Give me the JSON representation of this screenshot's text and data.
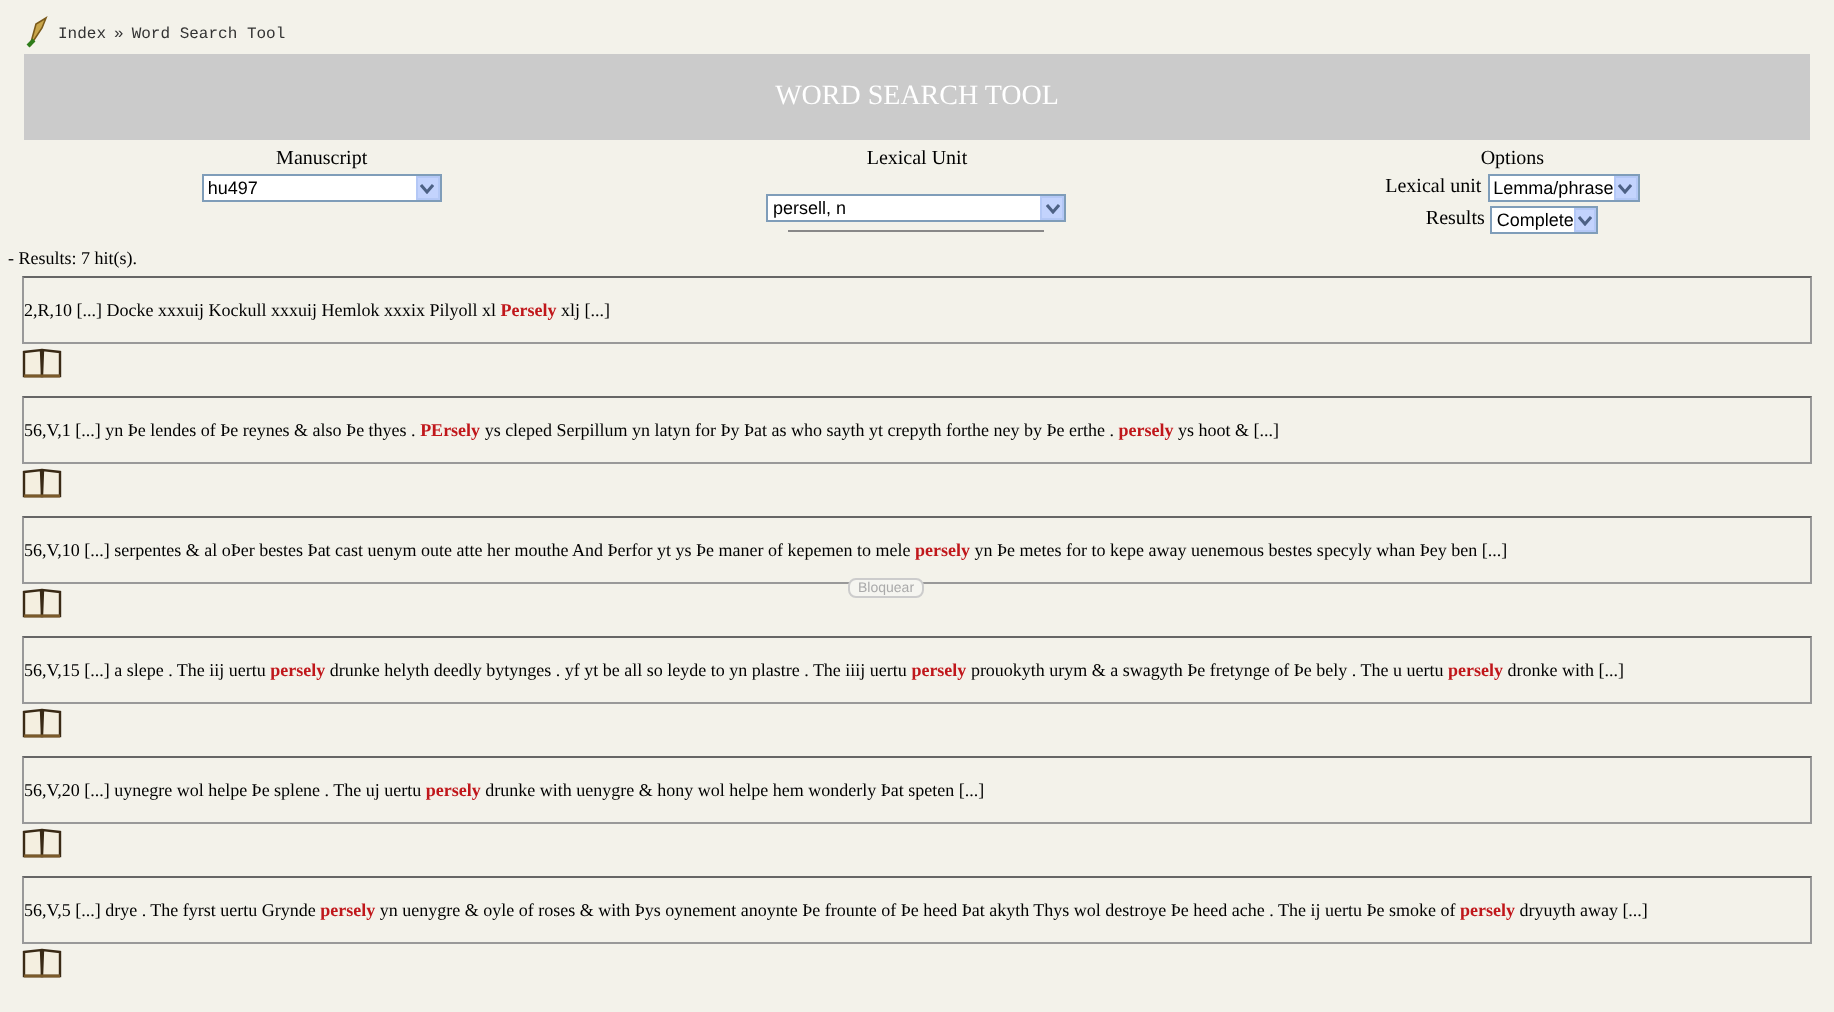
{
  "breadcrumb": {
    "home": "Index",
    "separator": "»",
    "current": "Word Search Tool"
  },
  "header": {
    "title": "WORD SEARCH TOOL"
  },
  "form": {
    "manuscript": {
      "label": "Manuscript",
      "value": "hu497"
    },
    "lexical_unit": {
      "label": "Lexical Unit",
      "value": "persell, n"
    },
    "options": {
      "label": "Options",
      "fields": [
        {
          "label": "Lexical unit",
          "value": "Lemma/phrase"
        },
        {
          "label": "Results",
          "value": "Complete"
        }
      ]
    }
  },
  "results_summary": "- Results: 7 hit(s).",
  "results": [
    {
      "text": "2,R,10 [...] Docke xxxuij Kockull xxxuij Hemlok xxxix Pilyoll xl **Persely** xlj [...]"
    },
    {
      "text": "56,V,1 [...] yn Þe lendes of Þe reynes & also Þe thyes . **PErsely** ys cleped Serpillum yn latyn for Þy Þat as who sayth yt crepyth forthe ney by Þe erthe . **persely** ys hoot & [...]"
    },
    {
      "text": "56,V,10 [...] serpentes & al oÞer bestes Þat cast uenym oute atte her mouthe And Þerfor yt ys Þe maner of kepemen to mele **persely** yn Þe metes for to kepe away uenemous bestes specyly whan Þey ben [...]"
    },
    {
      "text": "56,V,15 [...] a slepe . The iij uertu **persely** drunke helyth deedly bytynges . yf yt be all so leyde to yn plastre . The iiij uertu **persely** prouokyth urym & a swagyth Þe fretynge of Þe bely . The u uertu **persely** dronke with [...]"
    },
    {
      "text": "56,V,20 [...] uynegre wol helpe Þe splene . The uj uertu **persely** drunke with uenygre & hony wol helpe hem wonderly Þat speten [...]"
    },
    {
      "text": "56,V,5 [...] drye . The fyrst uertu Grynde **persely** yn uenygre & oyle of roses & with Þys oynement anoynte Þe frounte of Þe heed Þat akyth Thys wol destroye Þe heed ache . The ij uertu Þe smoke of **persely** dryuyth away [...]"
    }
  ],
  "overlay_button": "Bloquear"
}
